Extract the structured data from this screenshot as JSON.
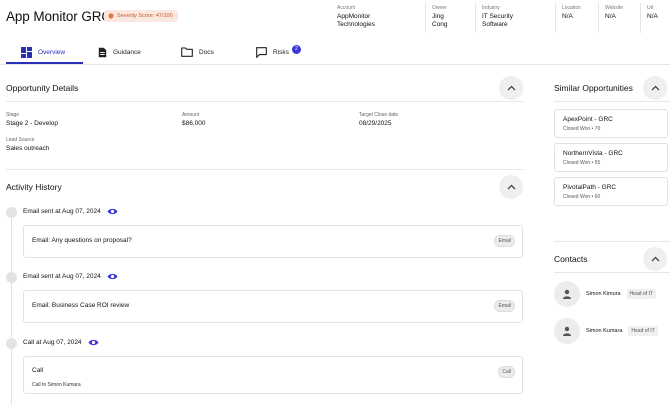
{
  "header": {
    "title": "App Monitor GRC",
    "severity_badge": "Severity Score: 47/100",
    "meta": [
      {
        "label": "Account",
        "value_line1": "AppMonitor",
        "value_line2": "Technologies"
      },
      {
        "label": "Owner",
        "value_line1": "Jing",
        "value_line2": "Cong"
      },
      {
        "label": "Industry",
        "value_line1": "IT Security",
        "value_line2": "Software"
      },
      {
        "label": "Location",
        "value_line1": "N/A",
        "value_line2": ""
      },
      {
        "label": "Website",
        "value_line1": "N/A",
        "value_line2": ""
      },
      {
        "label": "Url",
        "value_line1": "N/A",
        "value_line2": ""
      }
    ]
  },
  "tabs": [
    {
      "label": "Overview",
      "icon": "grid-icon",
      "active": true
    },
    {
      "label": "Guidance",
      "icon": "document-icon"
    },
    {
      "label": "Docs",
      "icon": "folder-icon"
    },
    {
      "label": "Risks",
      "icon": "chat-icon",
      "count": "2"
    }
  ],
  "opportunity": {
    "title": "Opportunity Details",
    "fields": [
      {
        "label": "Stage",
        "value": "Stage 2 - Develop"
      },
      {
        "label": "Amount",
        "value": "$86,000"
      },
      {
        "label": "Target Close date",
        "value": "08/29/2025"
      },
      {
        "label": "Lead Source",
        "value": "Sales outreach"
      }
    ]
  },
  "activity": {
    "title": "Activity History",
    "items": [
      {
        "heading": "Email sent at Aug 07, 2024",
        "text": "Email: Any questions on proposal?",
        "sub": "",
        "tag": "Email"
      },
      {
        "heading": "Email sent at Aug 07, 2024",
        "text": "Email: Business Case ROI review",
        "sub": "",
        "tag": "Email"
      },
      {
        "heading": "Call at Aug 07, 2024",
        "text": "Call",
        "sub": "Call to Simon Kumara",
        "tag": "Call"
      }
    ]
  },
  "similar": {
    "title": "Similar Opportunities",
    "items": [
      {
        "name": "ApexPoint - GRC",
        "sub": "Closed Won  •  70"
      },
      {
        "name": "NorthernVista - GRC",
        "sub": "Closed Won  •  55"
      },
      {
        "name": "PivotalPath - GRC",
        "sub": "Closed Won  •  60"
      }
    ]
  },
  "contacts": {
    "title": "Contacts",
    "items": [
      {
        "name": "Simon Kimura",
        "role": "Head of IT"
      },
      {
        "name": "Simon Kumara",
        "role": "Head of IT"
      }
    ]
  },
  "colors": {
    "accent": "#2b2fb8",
    "badge_bg": "#fbe9e1",
    "badge_text": "#c0582e",
    "eye": "#3b35d8"
  }
}
